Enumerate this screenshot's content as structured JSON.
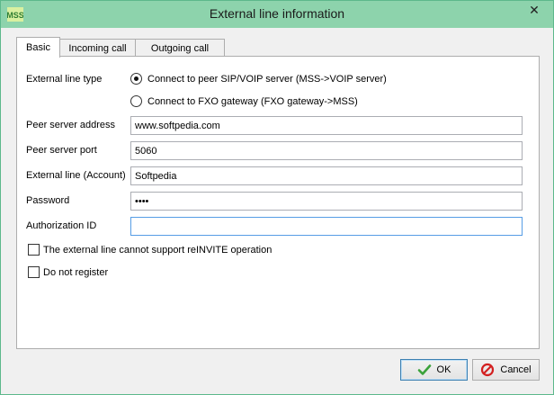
{
  "window": {
    "title": "External line information",
    "close_glyph": "✕",
    "icon": "mss-app-icon"
  },
  "tabs": [
    {
      "label": "Basic",
      "active": true
    },
    {
      "label": "Incoming call",
      "active": false
    },
    {
      "label": "Outgoing call",
      "active": false
    }
  ],
  "basic": {
    "line_type_label": "External line type",
    "line_type_options": [
      {
        "label": "Connect to peer SIP/VOIP server (MSS->VOIP server)",
        "selected": true
      },
      {
        "label": "Connect to FXO gateway (FXO gateway->MSS)",
        "selected": false
      }
    ],
    "peer_address": {
      "label": "Peer server address",
      "value": "www.softpedia.com"
    },
    "peer_port": {
      "label": "Peer server port",
      "value": "5060"
    },
    "account": {
      "label": "External line (Account)",
      "value": "Softpedia"
    },
    "password": {
      "label": "Password",
      "value": "1234"
    },
    "auth_id": {
      "label": "Authorization ID",
      "value": ""
    },
    "no_reinvite": {
      "label": "The external line cannot support reINVITE operation",
      "checked": false
    },
    "no_register": {
      "label": "Do not register",
      "checked": false
    }
  },
  "buttons": {
    "ok": {
      "label": "OK",
      "icon": "checkmark-icon"
    },
    "cancel": {
      "label": "Cancel",
      "icon": "cancel-icon"
    }
  },
  "colors": {
    "titlebar": "#8dd3ac",
    "ok_check": "#3aa23a",
    "cancel_red": "#d32020"
  }
}
